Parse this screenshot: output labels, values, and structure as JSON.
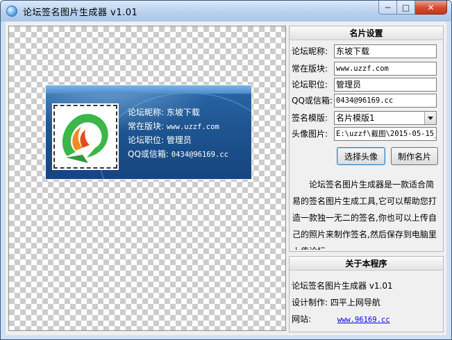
{
  "window": {
    "title": "论坛签名图片生成器 v1.01",
    "minimize": "─",
    "maximize": "□",
    "close": "✕"
  },
  "card": {
    "nickname_line": "论坛昵称: 东坡下载",
    "board_label": "常在版块: ",
    "board_value": "www.uzzf.com",
    "position_line": "论坛职位: 管理员",
    "qq_label": "QQ或信箱: ",
    "qq_value": "0434@96169.cc"
  },
  "settings": {
    "title": "名片设置",
    "nickname_label": "论坛昵称:",
    "nickname_value": "东坡下载",
    "board_label": "常在版块:",
    "board_value": "www.uzzf.com",
    "position_label": "论坛职位:",
    "position_value": "管理员",
    "qq_label": "QQ或信箱:",
    "qq_value": "0434@96169.cc",
    "template_label": "签名模版:",
    "template_value": "名片模版1",
    "avatar_label": "头像图片:",
    "avatar_value": "E:\\uzzf\\截图\\2015-05-15_",
    "choose_avatar_button": "选择头像",
    "make_card_button": "制作名片",
    "description": "论坛签名图片生成器是一款适合简易的签名图片生成工具,它可以帮助您打造一款独一无二的签名,你也可以上传自己的照片来制作签名,然后保存到电脑里上传论坛。"
  },
  "about": {
    "title": "关于本程序",
    "app_name": "论坛签名图片生成器 v1.01",
    "designer": "设计制作: 四平上网导航",
    "site_label": "网站:",
    "site_link": "www.96169.cc"
  },
  "colors": {
    "card_blue": "#1e5591",
    "logo_green": "#3cb54a",
    "logo_orange": "#f28a1e",
    "link_blue": "#0000ee"
  }
}
